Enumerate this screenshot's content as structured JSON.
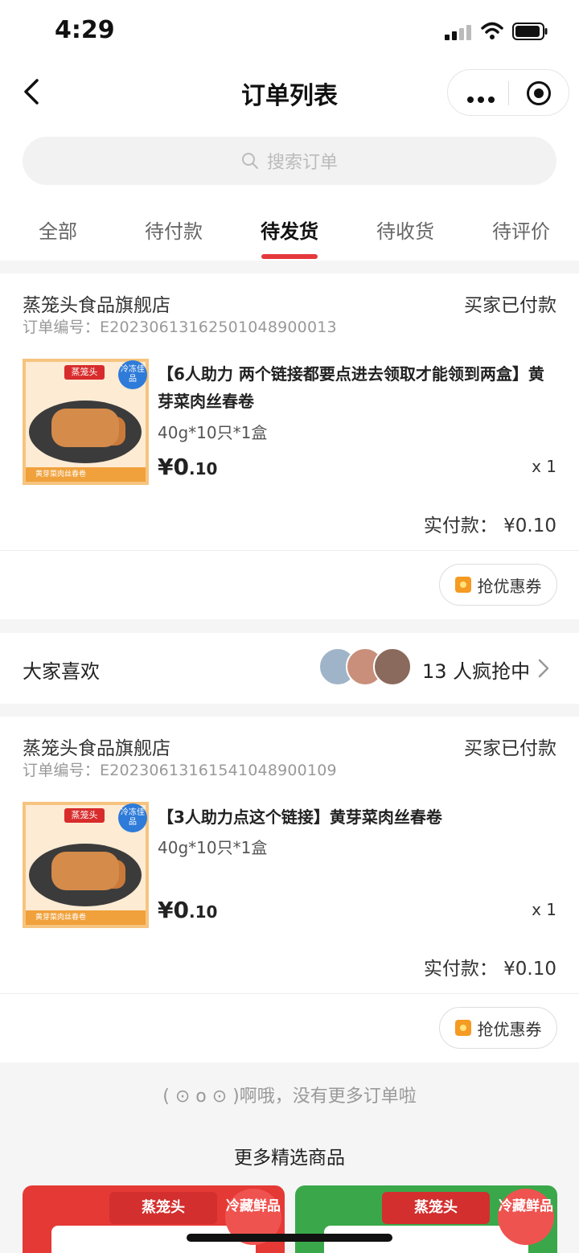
{
  "status_bar": {
    "time": "4:29"
  },
  "nav": {
    "title": "订单列表"
  },
  "search": {
    "placeholder": "搜索订单"
  },
  "tabs": [
    {
      "label": "全部"
    },
    {
      "label": "待付款"
    },
    {
      "label": "待发货",
      "active": true
    },
    {
      "label": "待收货"
    },
    {
      "label": "待评价"
    }
  ],
  "orders": [
    {
      "shop": "蒸笼头食品旗舰店",
      "status": "买家已付款",
      "order_no": "订单编号：E20230613162501048900013",
      "thumb_logo": "蒸笼头",
      "thumb_badge": "冷冻佳品",
      "thumb_strip": "黄芽菜肉丝春卷",
      "title": "【6人助力 两个链接都要点进去领取才能领到两盒】黄芽菜肉丝春卷",
      "spec": "40g*10只*1盒",
      "price_int": "¥0",
      "price_dec": ".10",
      "qty": "x 1",
      "paid": "实付款：  ¥0.10",
      "coupon": "抢优惠券"
    },
    {
      "shop": "蒸笼头食品旗舰店",
      "status": "买家已付款",
      "order_no": "订单编号：E20230613161541048900109",
      "thumb_logo": "蒸笼头",
      "thumb_badge": "冷冻佳品",
      "thumb_strip": "黄芽菜肉丝春卷",
      "title": "【3人助力点这个链接】黄芽菜肉丝春卷",
      "spec": "40g*10只*1盒",
      "price_int": "¥0",
      "price_dec": ".10",
      "qty": "x 1",
      "paid": "实付款：  ¥0.10",
      "coupon": "抢优惠券"
    }
  ],
  "likes": {
    "label": "大家喜欢",
    "count": "13 人疯抢中"
  },
  "footer": {
    "no_more": "( ⊙ o ⊙ )啊哦，没有更多订单啦",
    "more_title": "更多精选商品"
  },
  "products": [
    {
      "logo": "蒸笼头",
      "badge": "冷藏鲜品",
      "bg": "#e53935",
      "logo_bg": "#d32f2f",
      "badge_bg": "#ef5350"
    },
    {
      "logo": "蒸笼头",
      "badge": "冷藏鲜品",
      "bg": "#3aa84a",
      "logo_bg": "#d32f2f",
      "badge_bg": "#ef5350"
    }
  ]
}
